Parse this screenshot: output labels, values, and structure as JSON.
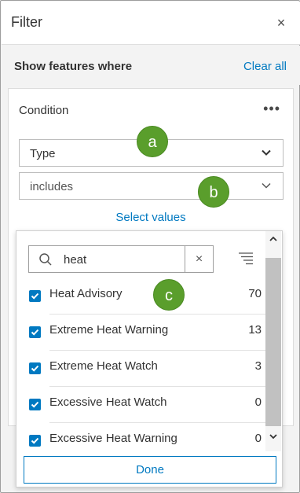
{
  "header": {
    "title": "Filter",
    "close_glyph": "×"
  },
  "filter": {
    "show_label": "Show features where",
    "clear_all_label": "Clear all"
  },
  "condition": {
    "label": "Condition",
    "more_glyph": "•••",
    "field_select": {
      "value": "Type",
      "icon": "chevron-down-icon"
    },
    "operator_select": {
      "value": "includes",
      "icon": "chevron-down-icon"
    },
    "select_values_label": "Select values"
  },
  "markers": {
    "a": "a",
    "b": "b",
    "c": "c"
  },
  "values_dropdown": {
    "search": {
      "value": "heat",
      "clear_glyph": "×",
      "icon": "search-icon"
    },
    "sort_icon": "sort-list-icon",
    "items": [
      {
        "label": "Heat Advisory",
        "count": "70",
        "checked": true
      },
      {
        "label": "Extreme Heat Warning",
        "count": "13",
        "checked": true
      },
      {
        "label": "Extreme Heat Watch",
        "count": "3",
        "checked": true
      },
      {
        "label": "Excessive Heat Watch",
        "count": "0",
        "checked": true
      },
      {
        "label": "Excessive Heat Warning",
        "count": "0",
        "checked": true
      }
    ],
    "scroll_up_glyph": "▲",
    "scroll_down_glyph": "▼",
    "done_label": "Done"
  },
  "colors": {
    "accent": "#0079c1",
    "marker": "#5a9e2c",
    "checkbox": "#0079c1"
  }
}
